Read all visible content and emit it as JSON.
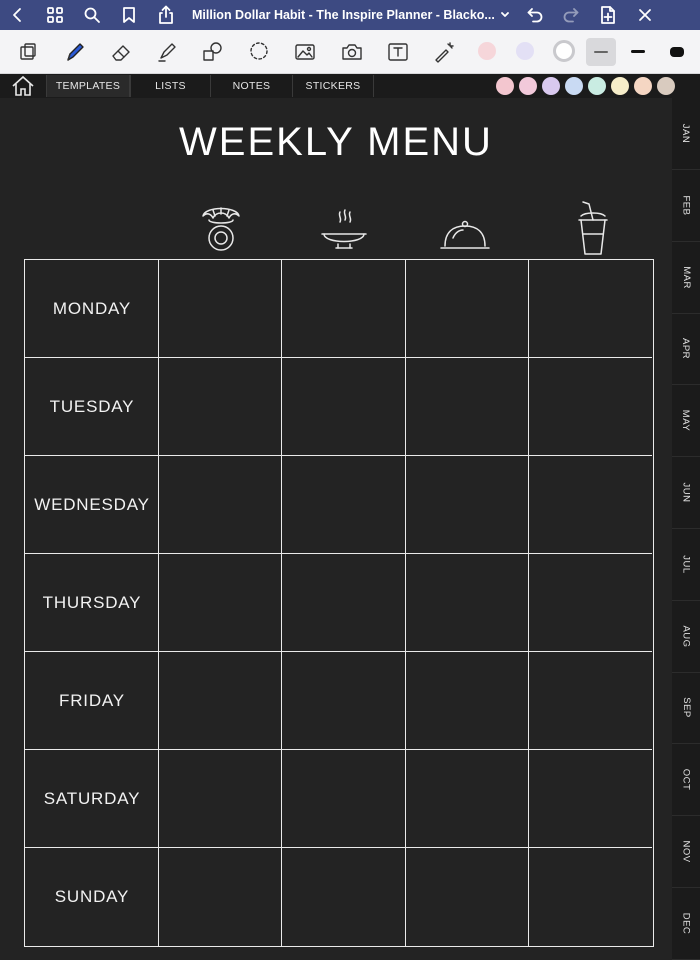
{
  "app_bar": {
    "doc_title": "Million Dollar Habit - The Inspire Planner - Blacko...",
    "icons": [
      "chevron-left-icon",
      "grid-icon",
      "search-icon",
      "bookmark-icon",
      "share-icon",
      "chevron-down-icon",
      "undo-icon",
      "redo-icon",
      "add-page-icon",
      "close-icon"
    ],
    "bg_color": "#3d4a82"
  },
  "toolbar": {
    "tools": [
      "zoom-tool-icon",
      "pen-icon",
      "eraser-icon",
      "highlighter-icon",
      "shapes-icon",
      "lasso-icon",
      "image-icon",
      "camera-icon",
      "text-icon",
      "laser-pointer-icon"
    ],
    "pen_colors": [
      "#f6c9cf",
      "#dcd7f5",
      "#ffffff"
    ]
  },
  "nav": {
    "tabs": [
      "TEMPLATES",
      "LISTS",
      "NOTES",
      "STICKERS"
    ],
    "swatches": [
      "#f3c6cf",
      "#f2c9da",
      "#d9c9ef",
      "#c9daf3",
      "#c9ece2",
      "#f6edc9",
      "#f5d6c3",
      "#d9cbbf"
    ]
  },
  "page": {
    "title": "WEEKLY MENU",
    "meal_icons": [
      "breakfast-croissant-coffee-icon",
      "soup-bowl-icon",
      "serving-cloche-icon",
      "drink-cup-icon"
    ],
    "days": [
      "MONDAY",
      "TUESDAY",
      "WEDNESDAY",
      "THURSDAY",
      "FRIDAY",
      "SATURDAY",
      "SUNDAY"
    ]
  },
  "months": [
    "JAN",
    "FEB",
    "MAR",
    "APR",
    "MAY",
    "JUN",
    "JUL",
    "AUG",
    "SEP",
    "OCT",
    "NOV",
    "DEC"
  ]
}
